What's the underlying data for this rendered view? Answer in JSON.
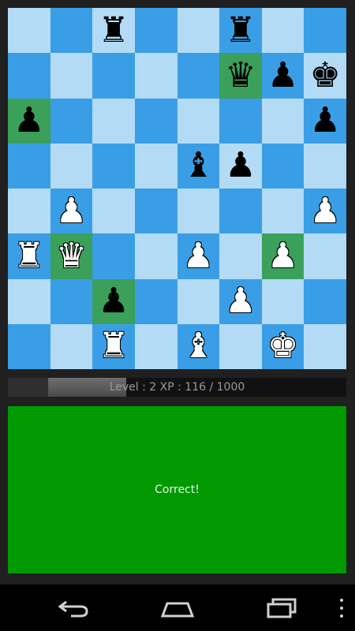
{
  "board": {
    "ranks": [
      [
        "",
        "",
        "r",
        "",
        "",
        "r",
        "",
        ""
      ],
      [
        "",
        "",
        "",
        "",
        "",
        "q",
        "p",
        "k"
      ],
      [
        "p",
        "",
        "",
        "",
        "",
        "",
        "",
        "p"
      ],
      [
        "",
        "",
        "",
        "",
        "b",
        "p",
        "",
        ""
      ],
      [
        "",
        "P",
        "",
        "",
        "",
        "",
        "",
        "P"
      ],
      [
        "R",
        "Q",
        "",
        "",
        "P",
        "",
        "P",
        ""
      ],
      [
        "",
        "",
        "p",
        "",
        "",
        "P",
        "",
        ""
      ],
      [
        "",
        "",
        "R",
        "",
        "B",
        "",
        "K",
        ""
      ]
    ],
    "highlighted": [
      [
        1,
        5
      ],
      [
        2,
        0
      ],
      [
        5,
        1
      ],
      [
        5,
        6
      ],
      [
        6,
        2
      ]
    ],
    "colors": {
      "light": "#b3dbf6",
      "dark": "#3a9ee6",
      "highlight": "#3aa05a"
    }
  },
  "xp": {
    "label": "Level : 2 XP : 116 / 1000",
    "progress": 0.35,
    "previous_progress": 0.12
  },
  "result": {
    "message": "Correct!",
    "color": "#009900"
  },
  "navbar": {
    "back_icon": "back-icon",
    "home_icon": "home-icon",
    "recents_icon": "recent-apps-icon",
    "menu_icon": "overflow-menu-icon"
  }
}
